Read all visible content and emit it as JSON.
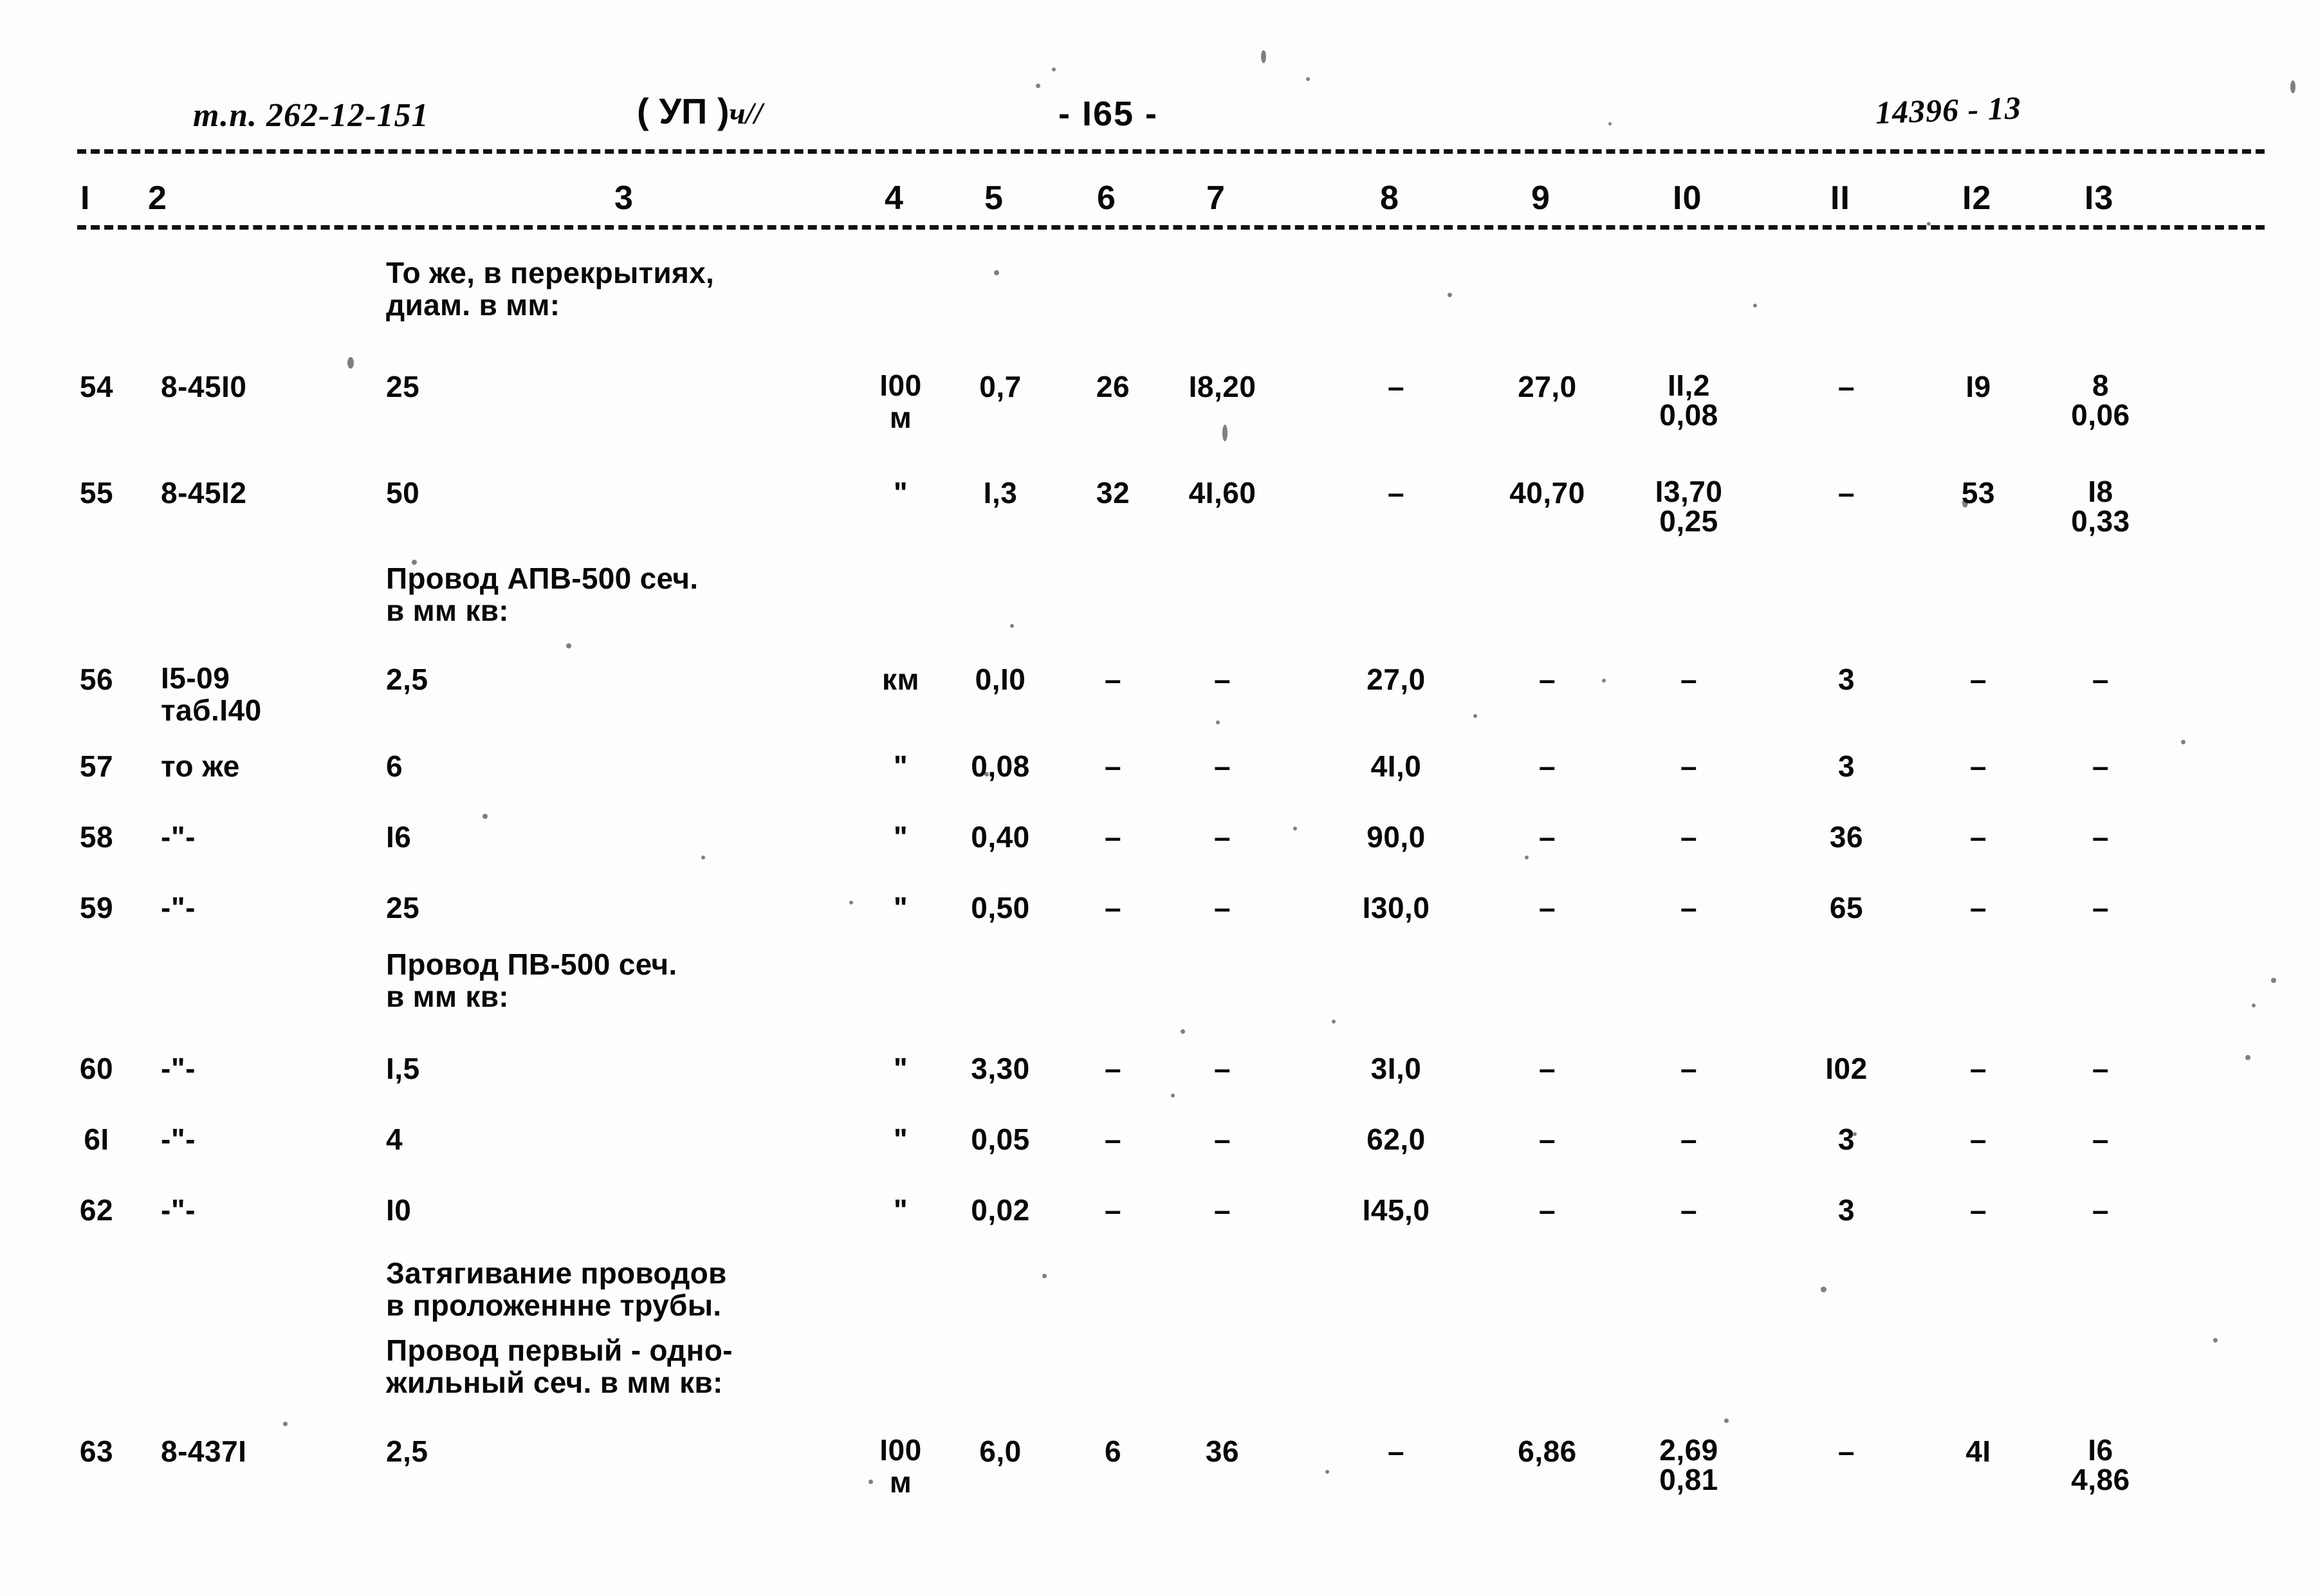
{
  "header": {
    "doc_code": "т.п. 262-12-151",
    "section_printed": "( УП )",
    "section_hand": "ч//",
    "page_number": "- I65 -",
    "archive_number": "14396 - 13"
  },
  "table": {
    "column_numbers": [
      "I",
      "2",
      "3",
      "4",
      "5",
      "6",
      "7",
      "8",
      "9",
      "I0",
      "II",
      "I2",
      "I3"
    ],
    "rows": [
      {
        "kind": "group",
        "c3": "То же, в перекрытиях,\nдиам. в мм:"
      },
      {
        "kind": "data",
        "c1": "54",
        "c2": "8-45I0",
        "c3": "25",
        "c4": "I00\nм",
        "c5": "0,7",
        "c6": "26",
        "c7": "I8,20",
        "c8": "–",
        "c9": "27,0",
        "c10": "II,2\n0,08",
        "c11": "–",
        "c12": "I9",
        "c13": "8\n0,06"
      },
      {
        "kind": "data",
        "c1": "55",
        "c2": "8-45I2",
        "c3": "50",
        "c4": "\"",
        "c5": "I,3",
        "c6": "32",
        "c7": "4I,60",
        "c8": "–",
        "c9": "40,70",
        "c10": "I3,70\n0,25",
        "c11": "–",
        "c12": "53",
        "c13": "I8\n0,33"
      },
      {
        "kind": "group",
        "c3": "Провод АПВ-500 сеч.\nв мм кв:"
      },
      {
        "kind": "data",
        "c1": "56",
        "c2": "I5-09\nтаб.I40",
        "c3": "2,5",
        "c4": "км",
        "c5": "0,I0",
        "c6": "–",
        "c7": "–",
        "c8": "27,0",
        "c9": "–",
        "c10": "–",
        "c11": "3",
        "c12": "–",
        "c13": "–"
      },
      {
        "kind": "data",
        "c1": "57",
        "c2": "то же",
        "c3": "6",
        "c4": "\"",
        "c5": "0,08",
        "c6": "–",
        "c7": "–",
        "c8": "4I,0",
        "c9": "–",
        "c10": "–",
        "c11": "3",
        "c12": "–",
        "c13": "–"
      },
      {
        "kind": "data",
        "c1": "58",
        "c2": "-\"-",
        "c3": "I6",
        "c4": "\"",
        "c5": "0,40",
        "c6": "–",
        "c7": "–",
        "c8": "90,0",
        "c9": "–",
        "c10": "–",
        "c11": "36",
        "c12": "–",
        "c13": "–"
      },
      {
        "kind": "data",
        "c1": "59",
        "c2": "-\"-",
        "c3": "25",
        "c4": "\"",
        "c5": "0,50",
        "c6": "–",
        "c7": "–",
        "c8": "I30,0",
        "c9": "–",
        "c10": "–",
        "c11": "65",
        "c12": "–",
        "c13": "–"
      },
      {
        "kind": "group",
        "c3": "Провод ПВ-500 сеч.\nв мм кв:"
      },
      {
        "kind": "data",
        "c1": "60",
        "c2": "-\"-",
        "c3": "I,5",
        "c4": "\"",
        "c5": "3,30",
        "c6": "–",
        "c7": "–",
        "c8": "3I,0",
        "c9": "–",
        "c10": "–",
        "c11": "I02",
        "c12": "–",
        "c13": "–"
      },
      {
        "kind": "data",
        "c1": "6I",
        "c2": "-\"-",
        "c3": "4",
        "c4": "\"",
        "c5": "0,05",
        "c6": "–",
        "c7": "–",
        "c8": "62,0",
        "c9": "–",
        "c10": "–",
        "c11": "3",
        "c12": "–",
        "c13": "–"
      },
      {
        "kind": "data",
        "c1": "62",
        "c2": "-\"-",
        "c3": "I0",
        "c4": "\"",
        "c5": "0,02",
        "c6": "–",
        "c7": "–",
        "c8": "I45,0",
        "c9": "–",
        "c10": "–",
        "c11": "3",
        "c12": "–",
        "c13": "–"
      },
      {
        "kind": "group",
        "c3": "Затягивание проводов\nв проложеннне трубы."
      },
      {
        "kind": "group",
        "c3": "Провод первый - одно-\nжильный сеч. в мм кв:"
      },
      {
        "kind": "data",
        "c1": "63",
        "c2": "8-437I",
        "c3": "2,5",
        "c4": "I00\nм",
        "c5": "6,0",
        "c6": "6",
        "c7": "36",
        "c8": "–",
        "c9": "6,86",
        "c10": "2,69\n0,81",
        "c11": "–",
        "c12": "4I",
        "c13": "I6\n4,86"
      }
    ]
  }
}
